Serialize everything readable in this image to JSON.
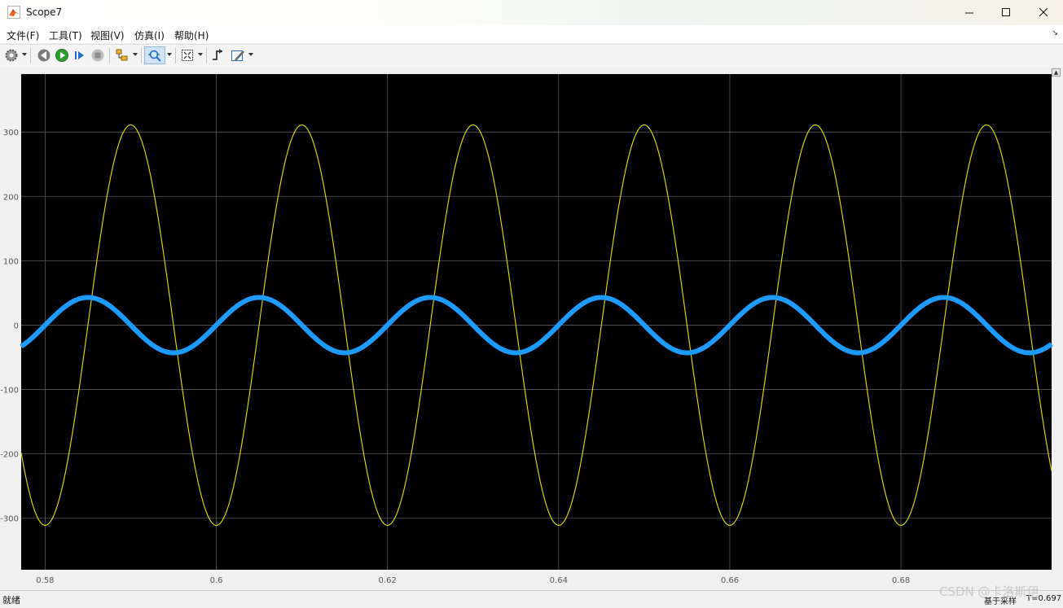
{
  "window": {
    "title": "Scope7",
    "icon": "matlab-icon",
    "controls": [
      "minimize-icon",
      "maximize-icon",
      "close-icon"
    ]
  },
  "menu": {
    "items": [
      {
        "label": "文件(F)"
      },
      {
        "label": "工具(T)"
      },
      {
        "label": "视图(V)"
      },
      {
        "label": "仿真(I)"
      },
      {
        "label": "帮助(H)"
      }
    ]
  },
  "toolbar": {
    "icons": [
      "settings-gear-icon",
      "step-back-icon",
      "run-icon",
      "step-forward-icon",
      "stop-icon",
      "highlight-simulink-block-icon",
      "zoom-icon",
      "autoscale-icon",
      "triggers-icon",
      "style-icon"
    ]
  },
  "colors": {
    "plot_background": "#000000",
    "frame": "#f0f0f0",
    "grid": "#5a5a5a",
    "tick_text": "#d0d0d0",
    "series1": "#e6e600",
    "series2": "#1e9bff"
  },
  "chart_data": {
    "type": "line",
    "title": "",
    "xlabel": "",
    "ylabel": "",
    "xlim": [
      0.5772,
      0.6976
    ],
    "ylim": [
      -380,
      390
    ],
    "xticks": [
      0.58,
      0.6,
      0.62,
      0.64,
      0.66,
      0.68
    ],
    "xtick_labels": [
      "0.58",
      "0.6",
      "0.62",
      "0.64",
      "0.66",
      "0.68"
    ],
    "yticks": [
      300,
      200,
      100,
      0,
      -100,
      -200,
      -300
    ],
    "ytick_labels": [
      "300",
      "200",
      "100",
      "0",
      "-100",
      "-200",
      "-300"
    ],
    "grid": true,
    "legend": "none",
    "series": [
      {
        "color": "#e6e600",
        "waveform": "sine",
        "amplitude": 311,
        "frequency_hz": 50,
        "phase_deg": -90,
        "line": "thin"
      },
      {
        "color": "#1e9bff",
        "waveform": "sine",
        "amplitude": 43,
        "frequency_hz": 50,
        "phase_deg": 0,
        "line": "thick"
      }
    ]
  },
  "status": {
    "left": "就绪",
    "mode": "基于采样",
    "time": "T=0.697"
  },
  "watermark": "CSDN @卡洛斯伊"
}
